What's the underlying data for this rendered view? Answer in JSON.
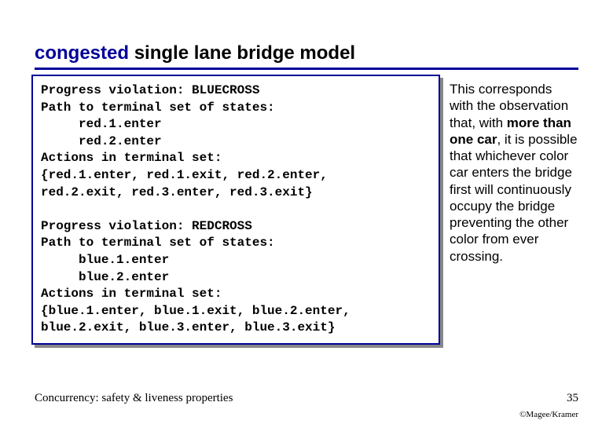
{
  "title": {
    "congested": "congested",
    "rest": " single lane bridge model"
  },
  "code": {
    "l1": "Progress violation: BLUECROSS",
    "l2": "Path to terminal set of states:",
    "l3": "     red.1.enter",
    "l4": "     red.2.enter",
    "l5": "Actions in terminal set:",
    "l6": "{red.1.enter, red.1.exit, red.2.enter,",
    "l7": "red.2.exit, red.3.enter, red.3.exit}",
    "l8": "",
    "l9": "Progress violation: REDCROSS",
    "l10": "Path to terminal set of states:",
    "l11": "     blue.1.enter",
    "l12": "     blue.2.enter",
    "l13": "Actions in terminal set:",
    "l14": "{blue.1.enter, blue.1.exit, blue.2.enter,",
    "l15": "blue.2.exit, blue.3.enter, blue.3.exit}"
  },
  "side": {
    "p1a": "This corresponds with the observation that, with ",
    "p1b": "more than one car",
    "p1c": ", it is possible that whichever color car enters the bridge first will continuously occupy the bridge preventing the other color from ever crossing."
  },
  "footer": {
    "left": "Concurrency: safety & liveness properties",
    "right": "35",
    "copyright": "©Magee/Kramer"
  }
}
